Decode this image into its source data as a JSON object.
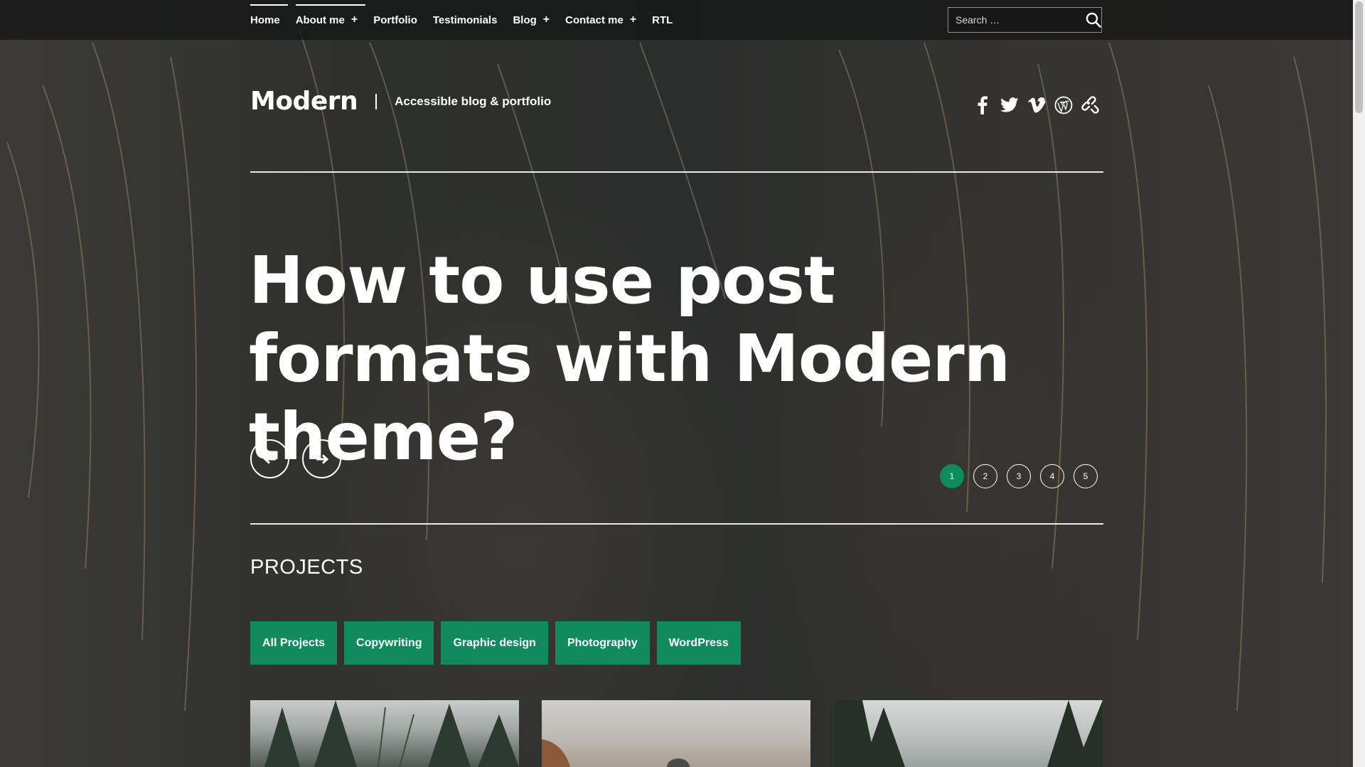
{
  "nav": {
    "items": [
      {
        "label": "Home",
        "submenu": false
      },
      {
        "label": "About me",
        "submenu": true
      },
      {
        "label": "Portfolio",
        "submenu": false
      },
      {
        "label": "Testimonials",
        "submenu": false
      },
      {
        "label": "Blog",
        "submenu": true
      },
      {
        "label": "Contact me",
        "submenu": true
      },
      {
        "label": "RTL",
        "submenu": false
      }
    ],
    "submenu_glyph": "+"
  },
  "search": {
    "placeholder": "Search …",
    "icon": "search-icon"
  },
  "branding": {
    "site_title": "Modern",
    "tagline": "Accessible blog & portfolio"
  },
  "social": [
    "facebook-icon",
    "twitter-icon",
    "vimeo-icon",
    "wordpress-icon",
    "link-icon"
  ],
  "hero": {
    "title": "How to use post formats with Modern theme?",
    "prev_icon": "arrow-left-icon",
    "next_icon": "arrow-right-icon",
    "pages": [
      "1",
      "2",
      "3",
      "4",
      "5"
    ],
    "current_page": "1"
  },
  "projects": {
    "heading": "PROJECTS",
    "filters": [
      "All Projects",
      "Copywriting",
      "Graphic design",
      "Photography",
      "WordPress"
    ]
  },
  "colors": {
    "accent": "#128a5f",
    "text": "#ffffff",
    "topbar": "#141616"
  }
}
